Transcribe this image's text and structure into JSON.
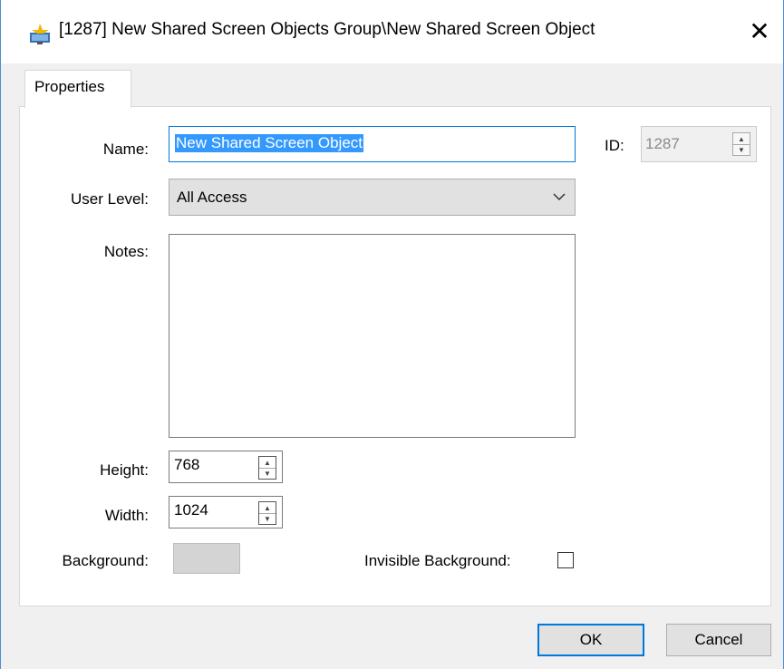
{
  "window": {
    "title": "[1287] New Shared Screen Objects Group\\New Shared Screen Object",
    "close_glyph": "✕"
  },
  "tabs": [
    {
      "label": "Properties",
      "active": true
    }
  ],
  "form": {
    "name_label": "Name:",
    "name_value": "New Shared Screen Object",
    "id_label": "ID:",
    "id_value": "1287",
    "user_level_label": "User Level:",
    "user_level_value": "All Access",
    "notes_label": "Notes:",
    "notes_value": "",
    "height_label": "Height:",
    "height_value": "768",
    "width_label": "Width:",
    "width_value": "1024",
    "background_label": "Background:",
    "background_color": "#d4d4d4",
    "invisible_background_label": "Invisible Background:",
    "invisible_background_checked": false
  },
  "buttons": {
    "ok": "OK",
    "cancel": "Cancel"
  },
  "icons": {
    "title_icon": "screen-object-icon",
    "close": "close-icon",
    "dropdown": "chevron-down-icon",
    "spin_up": "spin-up-icon",
    "spin_down": "spin-down-icon"
  },
  "colors": {
    "accent": "#0078d7",
    "selection": "#3399ff",
    "window_border": "#4b8fd8"
  }
}
